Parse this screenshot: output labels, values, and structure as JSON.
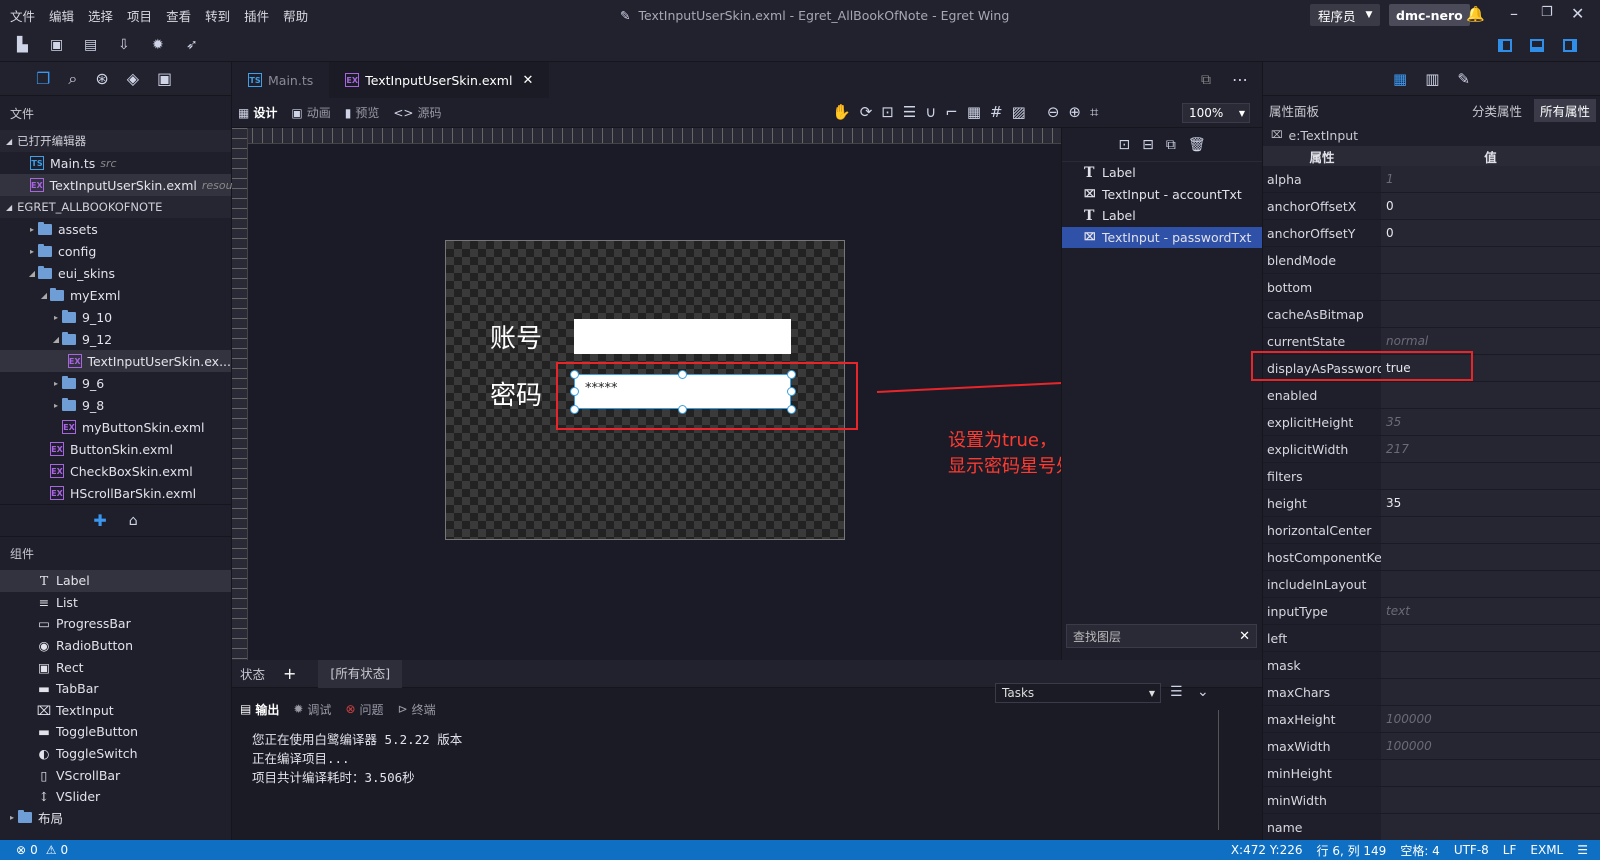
{
  "titlebar": {
    "menu": [
      "文件",
      "编辑",
      "选择",
      "项目",
      "查看",
      "转到",
      "插件",
      "帮助"
    ],
    "title": "TextInputUserSkin.exml - Egret_AllBookOfNote - Egret Wing",
    "role": "程序员",
    "user": "dmc-nero"
  },
  "left": {
    "files_title": "文件",
    "open_editors_title": "已打开编辑器",
    "open_editors": [
      {
        "name": "Main.ts",
        "hint": "src"
      },
      {
        "name": "TextInputUserSkin.exml",
        "hint": "resou..."
      }
    ],
    "project_title": "EGRET_ALLBOOKOFNOTE",
    "tree": [
      {
        "label": "assets",
        "type": "folder",
        "depth": 0,
        "arrow": "▸"
      },
      {
        "label": "config",
        "type": "folder",
        "depth": 0,
        "arrow": "▸"
      },
      {
        "label": "eui_skins",
        "type": "folder",
        "depth": 0,
        "arrow": "◢"
      },
      {
        "label": "myExml",
        "type": "folder",
        "depth": 1,
        "arrow": "◢"
      },
      {
        "label": "9_10",
        "type": "folder",
        "depth": 2,
        "arrow": "▸"
      },
      {
        "label": "9_12",
        "type": "folder",
        "depth": 2,
        "arrow": "◢"
      },
      {
        "label": "TextInputUserSkin.ex...",
        "type": "exml",
        "depth": 3,
        "arrow": ""
      },
      {
        "label": "9_6",
        "type": "folder",
        "depth": 2,
        "arrow": "▸"
      },
      {
        "label": "9_8",
        "type": "folder",
        "depth": 2,
        "arrow": "▸"
      },
      {
        "label": "myButtonSkin.exml",
        "type": "exml",
        "depth": 2,
        "arrow": ""
      },
      {
        "label": "ButtonSkin.exml",
        "type": "exml",
        "depth": 1,
        "arrow": ""
      },
      {
        "label": "CheckBoxSkin.exml",
        "type": "exml",
        "depth": 1,
        "arrow": ""
      },
      {
        "label": "HScrollBarSkin.exml",
        "type": "exml",
        "depth": 1,
        "arrow": ""
      }
    ],
    "components_title": "组件",
    "components": [
      {
        "label": "Label",
        "icon": "T"
      },
      {
        "label": "List",
        "icon": "≡"
      },
      {
        "label": "ProgressBar",
        "icon": "▭"
      },
      {
        "label": "RadioButton",
        "icon": "◉"
      },
      {
        "label": "Rect",
        "icon": "▣"
      },
      {
        "label": "TabBar",
        "icon": "▬"
      },
      {
        "label": "TextInput",
        "icon": "⌧"
      },
      {
        "label": "ToggleButton",
        "icon": "▬"
      },
      {
        "label": "ToggleSwitch",
        "icon": "◐"
      },
      {
        "label": "VScrollBar",
        "icon": "▯"
      },
      {
        "label": "VSlider",
        "icon": "↕"
      }
    ],
    "layout_folder": "布局"
  },
  "tabs": [
    {
      "label": "Main.ts"
    },
    {
      "label": "TextInputUserSkin.exml"
    }
  ],
  "designbar": {
    "design": "设计",
    "anim": "动画",
    "preview": "预览",
    "source": "源码",
    "zoom": "100%"
  },
  "stage": {
    "label_account": "账号",
    "label_password": "密码",
    "password_text": "*****"
  },
  "layers": {
    "items": [
      "Label",
      "TextInput - accountTxt",
      "Label",
      "TextInput - passwordTxt"
    ],
    "search_placeholder": "查找图层"
  },
  "annotation": {
    "line1": "设置为true， 则会进行",
    "line2": "显示密码星号处理。"
  },
  "states": {
    "label": "状态",
    "all": "[所有状态]"
  },
  "output": {
    "tabs": [
      "输出",
      "调试",
      "问题",
      "终端"
    ],
    "select": "Tasks",
    "lines": [
      "您正在使用白鹭编译器 5.2.22 版本",
      "正在编译项目...",
      "项目共计编译耗时：3.506秒"
    ]
  },
  "props": {
    "title": "属性面板",
    "cat": "分类属性",
    "all": "所有属性",
    "target": "e:TextInput",
    "col_name": "属性",
    "col_value": "值",
    "rows": [
      {
        "n": "alpha",
        "v": "1",
        "dim": true
      },
      {
        "n": "anchorOffsetX",
        "v": "0",
        "dim": false
      },
      {
        "n": "anchorOffsetY",
        "v": "0",
        "dim": false
      },
      {
        "n": "blendMode",
        "v": "",
        "dim": false
      },
      {
        "n": "bottom",
        "v": "",
        "dim": false
      },
      {
        "n": "cacheAsBitmap",
        "v": "",
        "dim": false
      },
      {
        "n": "currentState",
        "v": "normal",
        "dim": true
      },
      {
        "n": "displayAsPassword",
        "v": "true",
        "dim": false
      },
      {
        "n": "enabled",
        "v": "",
        "dim": false
      },
      {
        "n": "explicitHeight",
        "v": "35",
        "dim": true
      },
      {
        "n": "explicitWidth",
        "v": "217",
        "dim": true
      },
      {
        "n": "filters",
        "v": "",
        "dim": false
      },
      {
        "n": "height",
        "v": "35",
        "dim": false
      },
      {
        "n": "horizontalCenter",
        "v": "",
        "dim": false
      },
      {
        "n": "hostComponentKey",
        "v": "",
        "dim": false
      },
      {
        "n": "includeInLayout",
        "v": "",
        "dim": false
      },
      {
        "n": "inputType",
        "v": "text",
        "dim": true
      },
      {
        "n": "left",
        "v": "",
        "dim": false
      },
      {
        "n": "mask",
        "v": "",
        "dim": false
      },
      {
        "n": "maxChars",
        "v": "",
        "dim": false
      },
      {
        "n": "maxHeight",
        "v": "100000",
        "dim": true
      },
      {
        "n": "maxWidth",
        "v": "100000",
        "dim": true
      },
      {
        "n": "minHeight",
        "v": "",
        "dim": false
      },
      {
        "n": "minWidth",
        "v": "",
        "dim": false
      },
      {
        "n": "name",
        "v": "",
        "dim": false
      }
    ]
  },
  "status": {
    "errors": "0",
    "warnings": "0",
    "coords": "X:472 Y:226",
    "pos": "行 6, 列 149",
    "space": "空格: 4",
    "enc": "UTF-8",
    "eol": "LF",
    "lang": "EXML"
  },
  "colors": {
    "accent": "#0e6fc3",
    "highlight": "#e8262a",
    "selected_layer": "#3051a8"
  }
}
